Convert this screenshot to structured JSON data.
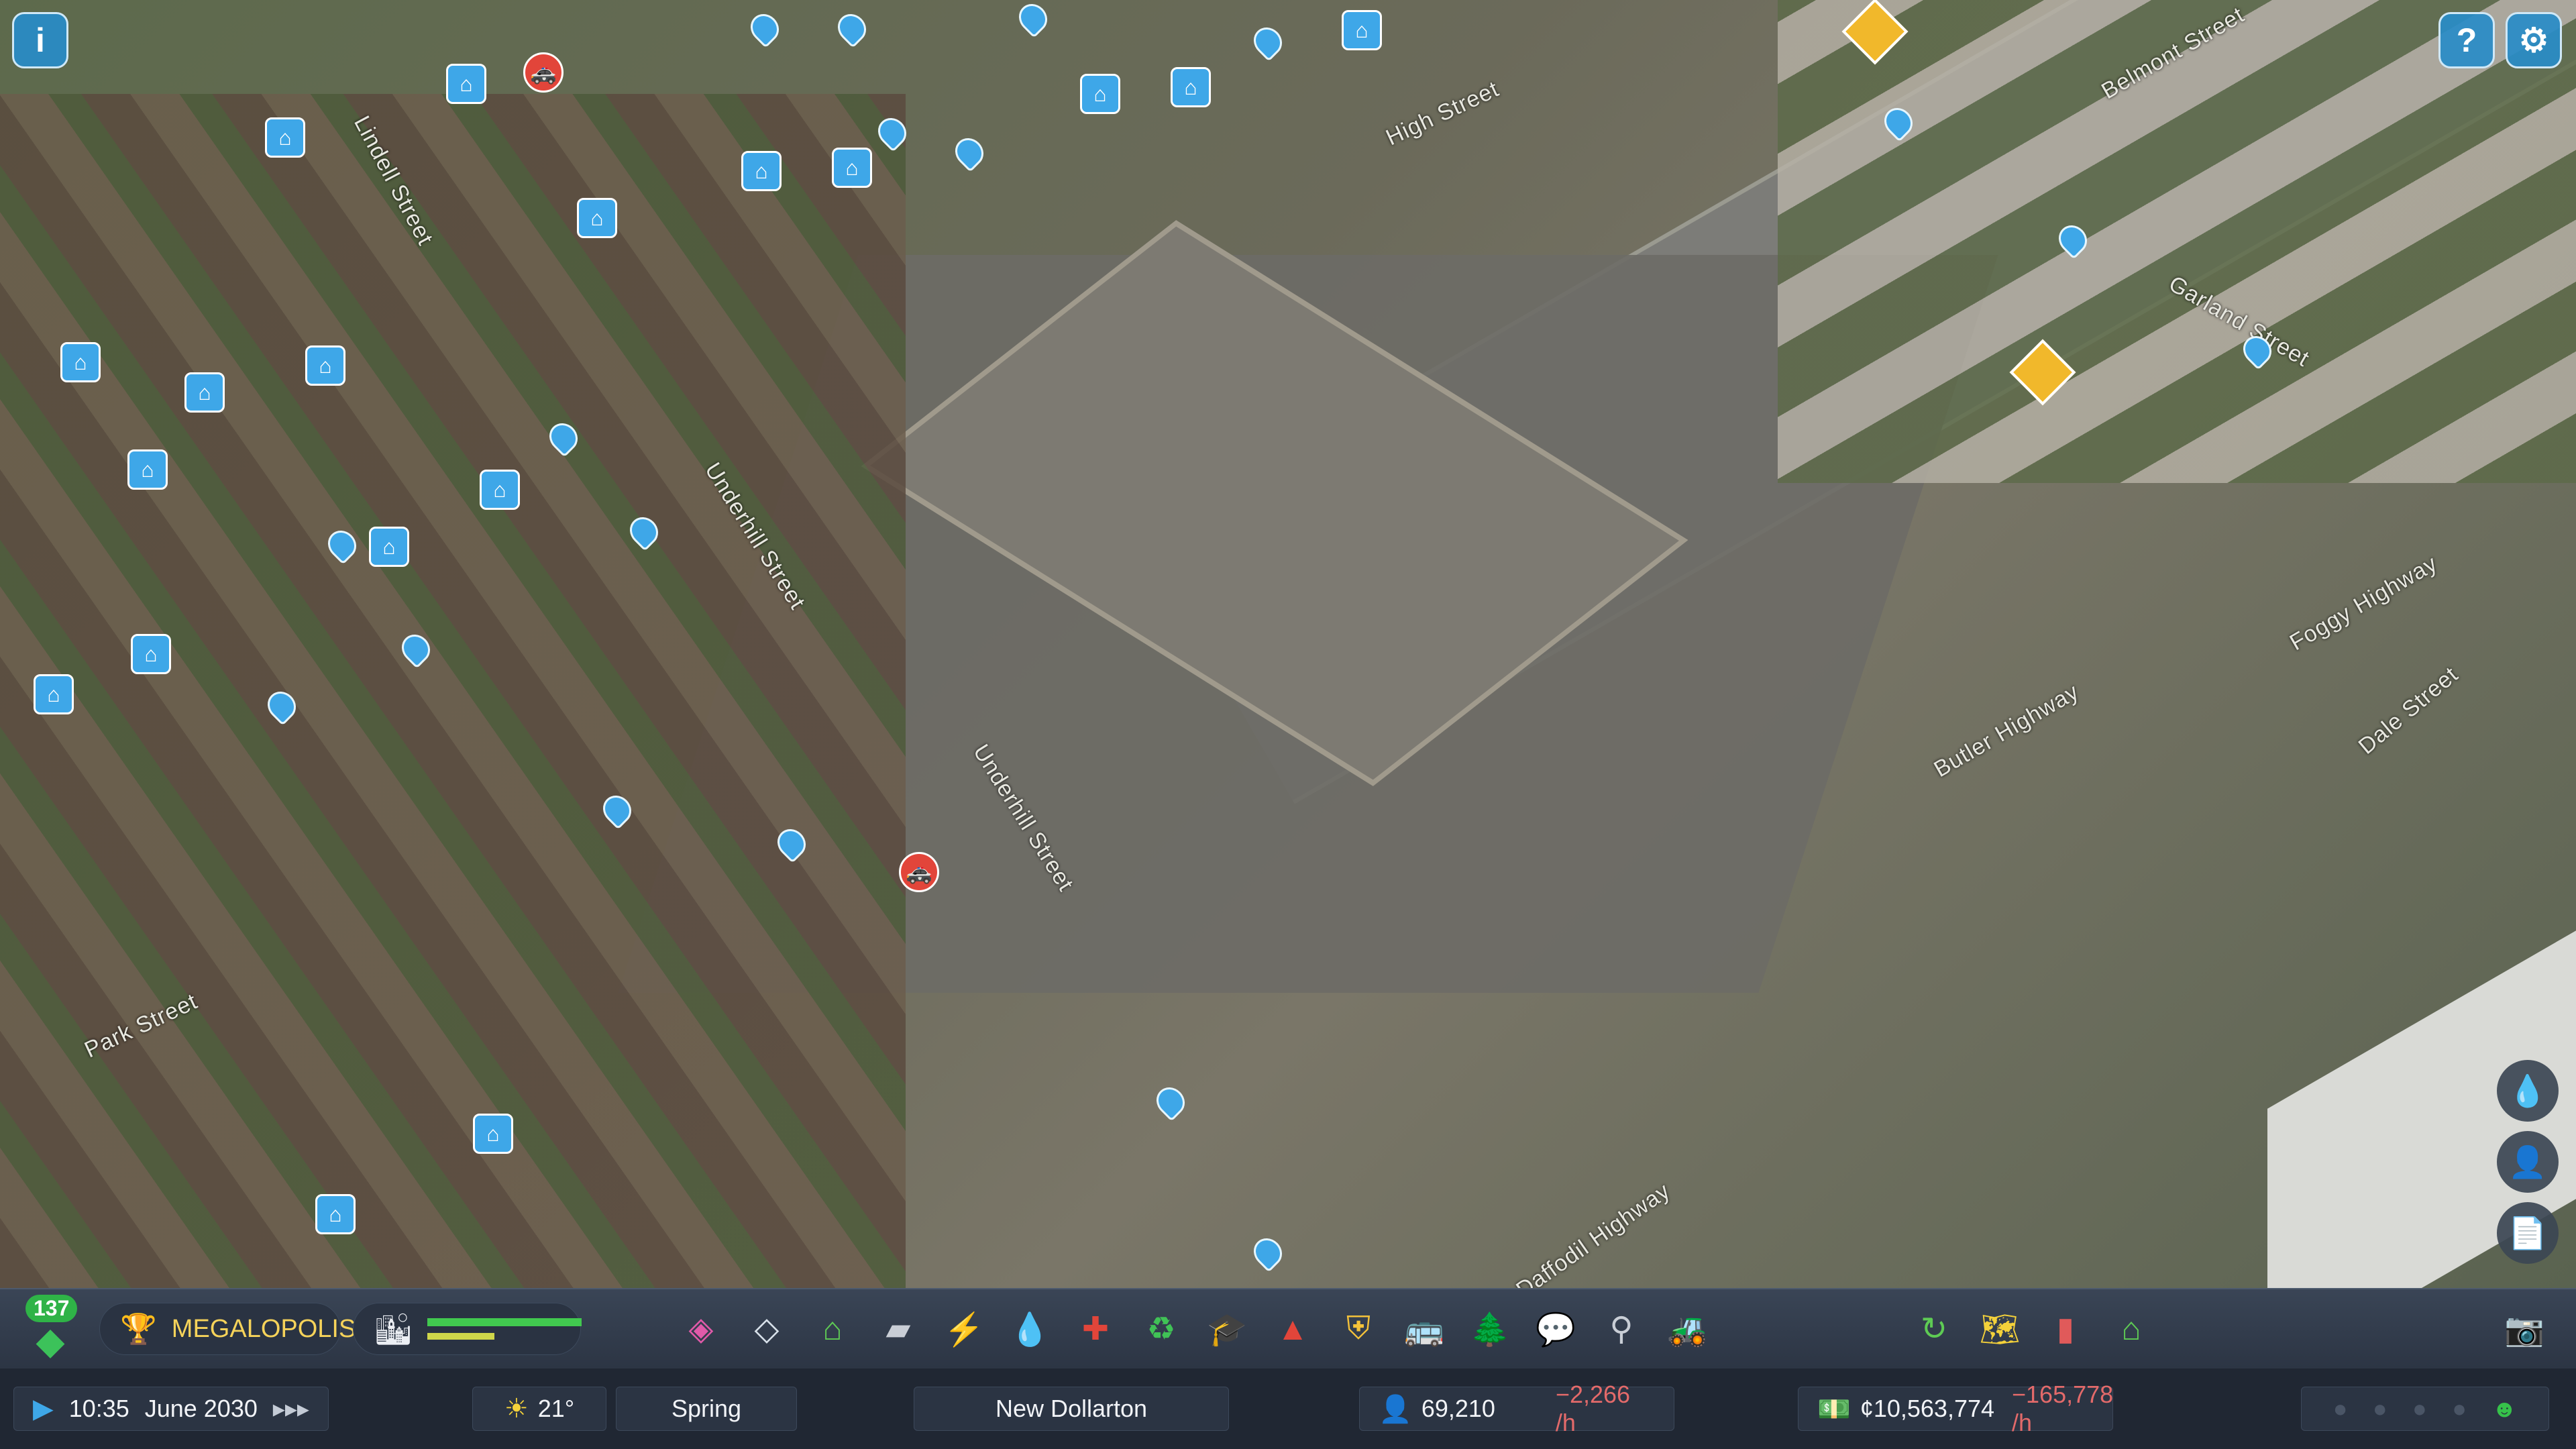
{
  "streets": [
    "Lindell Street",
    "High Street",
    "Underhill Street",
    "Underhill Street",
    "Park Street",
    "Butler Highway",
    "Foggy Highway",
    "Dale Street",
    "Daffodil Highway",
    "Garland Street",
    "Belmont Street"
  ],
  "milestone": {
    "level": "137",
    "title": "MEGALOPOLIS"
  },
  "time": {
    "clock": "10:35",
    "date": "June 2030"
  },
  "weather": {
    "temperature": "21°",
    "season": "Spring"
  },
  "city_name": "New Dollarton",
  "population": {
    "value": "69,210",
    "delta": "−2,266 /h"
  },
  "money": {
    "value": "¢10,563,774",
    "delta": "−165,778 /h"
  },
  "colors": {
    "accent": "#3ea7e8",
    "negative": "#e36a6a",
    "happy": "#36c24a",
    "toolbar": "#2c3544"
  },
  "toolbar_icons": [
    "zoning-icon",
    "area-icon",
    "building-icon",
    "road-icon",
    "electricity-icon",
    "water-icon",
    "healthcare-icon",
    "garbage-icon",
    "education-icon",
    "fire-icon",
    "police-icon",
    "transport-icon",
    "parks-icon",
    "communications-icon",
    "landscaping-icon",
    "bulldozer-icon"
  ],
  "right_toolbar_icons": [
    "progression-icon",
    "map-tiles-icon",
    "statistics-icon",
    "city-services-icon"
  ]
}
